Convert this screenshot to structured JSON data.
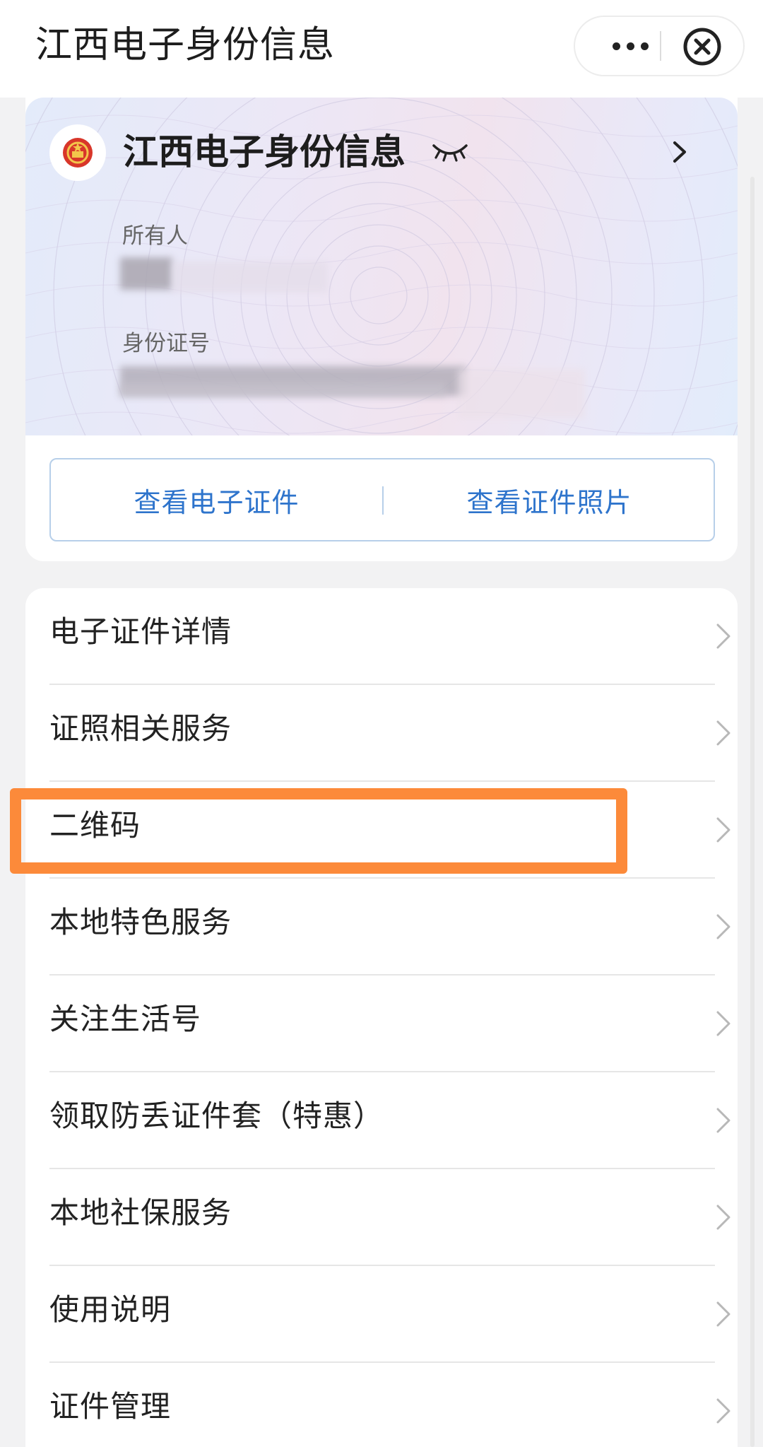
{
  "header": {
    "title": "江西电子身份信息",
    "more_icon": "more-dots-icon",
    "close_icon": "close-circle-icon"
  },
  "card": {
    "title": "江西电子身份信息",
    "owner_label": "所有人",
    "id_label": "身份证号",
    "eye_icon": "eye-closed-icon",
    "arrow_icon": "chevron-right-icon",
    "emblem_icon": "national-emblem-icon"
  },
  "actions": {
    "view_certificate": "查看电子证件",
    "view_photo": "查看证件照片"
  },
  "menu": {
    "items": [
      {
        "label": "电子证件详情"
      },
      {
        "label": "证照相关服务"
      },
      {
        "label": "二维码"
      },
      {
        "label": "本地特色服务"
      },
      {
        "label": "关注生活号"
      },
      {
        "label": "领取防丢证件套（特惠）"
      },
      {
        "label": "本地社保服务"
      },
      {
        "label": "使用说明"
      },
      {
        "label": "证件管理"
      }
    ]
  },
  "colors": {
    "accent_blue": "#2e74cc",
    "highlight_orange": "#fc8a3a"
  }
}
